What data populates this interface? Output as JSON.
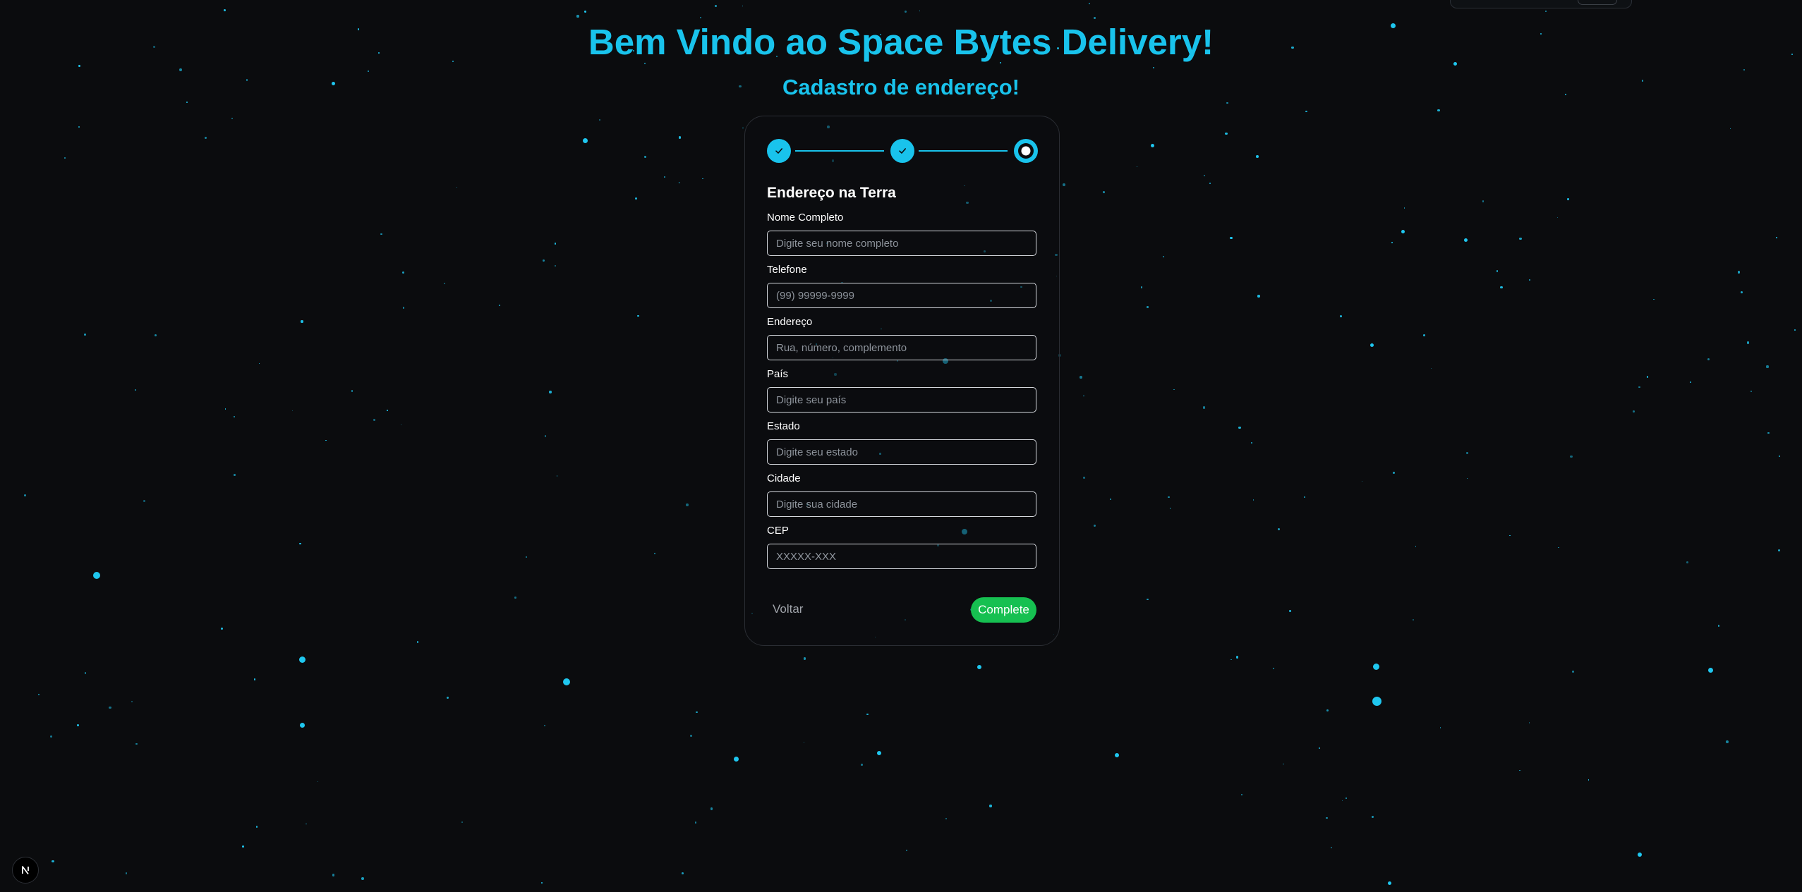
{
  "page": {
    "title": "Bem Vindo ao Space Bytes Delivery!",
    "subtitle": "Cadastro de endereço!"
  },
  "stepper": {
    "steps": [
      {
        "status": "complete"
      },
      {
        "status": "complete"
      },
      {
        "status": "current"
      }
    ],
    "total_steps": 3,
    "current_step": 3
  },
  "form": {
    "section_title": "Endereço na Terra",
    "fields": [
      {
        "label": "Nome Completo",
        "placeholder": "Digite seu nome completo",
        "value": ""
      },
      {
        "label": "Telefone",
        "placeholder": "(99) 99999-9999",
        "value": ""
      },
      {
        "label": "Endereço",
        "placeholder": "Rua, número, complemento",
        "value": ""
      },
      {
        "label": "País",
        "placeholder": "Digite seu país",
        "value": ""
      },
      {
        "label": "Estado",
        "placeholder": "Digite seu estado",
        "value": ""
      },
      {
        "label": "Cidade",
        "placeholder": "Digite sua cidade",
        "value": ""
      },
      {
        "label": "CEP",
        "placeholder": "XXXXX-XXX",
        "value": ""
      }
    ],
    "back_label": "Voltar",
    "submit_label": "Complete"
  },
  "icons": {
    "check": "check-icon",
    "current_step": "dot-icon",
    "nextjs_badge": "nextjs-logo-icon"
  },
  "colors": {
    "background": "#0b0c0e",
    "accent": "#19c3ec",
    "submit": "#16c051",
    "input_border": "#d4d7dc",
    "star": "#1fc7ef"
  }
}
